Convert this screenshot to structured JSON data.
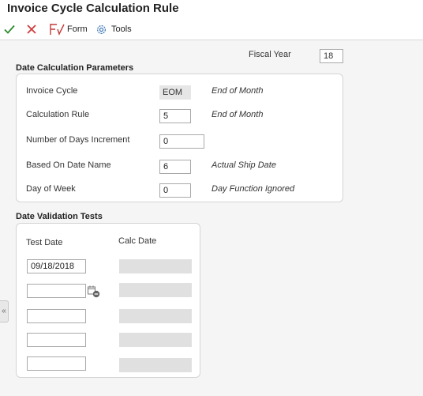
{
  "window": {
    "title": "Invoice Cycle Calculation Rule"
  },
  "toolbar": {
    "ok_icon": "checkmark-icon",
    "cancel_icon": "close-icon",
    "form_label": "Form",
    "tools_label": "Tools",
    "colors": {
      "ok": "#2a8a2a",
      "cancel": "#d23c3c",
      "form": "#c43a3a",
      "tools": "#3a73b5"
    }
  },
  "header": {
    "fiscal_year_label": "Fiscal Year",
    "fiscal_year_value": "18"
  },
  "date_calc": {
    "heading": "Date Calculation Parameters",
    "invoice_cycle": {
      "label": "Invoice Cycle",
      "value": "EOM",
      "description": "End of Month"
    },
    "calculation_rule": {
      "label": "Calculation Rule",
      "value": "5",
      "description": "End of Month"
    },
    "days_increment": {
      "label": "Number of Days Increment",
      "value": "0"
    },
    "based_on_date": {
      "label": "Based On Date Name",
      "value": "6",
      "description": "Actual Ship Date"
    },
    "day_of_week": {
      "label": "Day of Week",
      "value": "0",
      "description": "Day Function Ignored"
    }
  },
  "validation": {
    "heading": "Date Validation Tests",
    "test_date_header": "Test Date",
    "calc_date_header": "Calc Date",
    "rows": [
      {
        "test_date": "09/18/2018",
        "calc_date": ""
      },
      {
        "test_date": "",
        "calc_date": ""
      },
      {
        "test_date": "",
        "calc_date": ""
      },
      {
        "test_date": "",
        "calc_date": ""
      },
      {
        "test_date": "",
        "calc_date": ""
      }
    ]
  },
  "side_tab": {
    "label": "«"
  }
}
